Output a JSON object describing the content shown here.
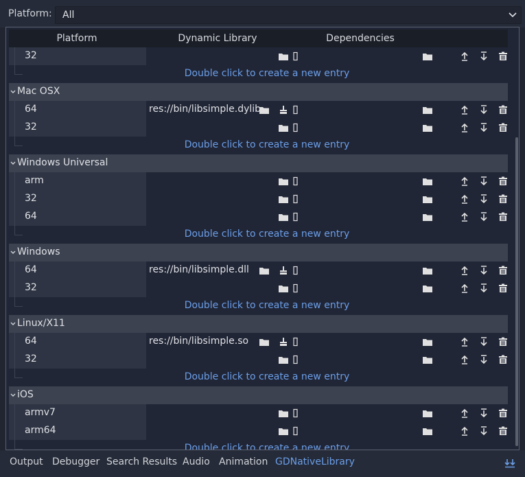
{
  "filter": {
    "label": "Platform:",
    "value": "All"
  },
  "columns": [
    "Platform",
    "Dynamic Library",
    "Dependencies"
  ],
  "new_entry_text": "Double click to create a new entry",
  "groups": [
    {
      "name": "",
      "entries": [
        {
          "arch": "32",
          "library": ""
        }
      ]
    },
    {
      "name": "Mac OSX",
      "entries": [
        {
          "arch": "64",
          "library": "res://bin/libsimple.dylib"
        },
        {
          "arch": "32",
          "library": ""
        }
      ]
    },
    {
      "name": "Windows Universal",
      "entries": [
        {
          "arch": "arm",
          "library": ""
        },
        {
          "arch": "32",
          "library": ""
        },
        {
          "arch": "64",
          "library": ""
        }
      ]
    },
    {
      "name": "Windows",
      "entries": [
        {
          "arch": "64",
          "library": "res://bin/libsimple.dll"
        },
        {
          "arch": "32",
          "library": ""
        }
      ]
    },
    {
      "name": "Linux/X11",
      "entries": [
        {
          "arch": "64",
          "library": "res://bin/libsimple.so"
        },
        {
          "arch": "32",
          "library": ""
        }
      ]
    },
    {
      "name": "iOS",
      "entries": [
        {
          "arch": "armv7",
          "library": ""
        },
        {
          "arch": "arm64",
          "library": ""
        }
      ]
    }
  ],
  "bottom_tabs": [
    "Output",
    "Debugger",
    "Search Results",
    "Audio",
    "Animation",
    "GDNativeLibrary"
  ],
  "active_tab": "GDNativeLibrary",
  "colors": {
    "accent": "#6b9ee8",
    "background": "#202531",
    "group_header": "#3c4250"
  }
}
